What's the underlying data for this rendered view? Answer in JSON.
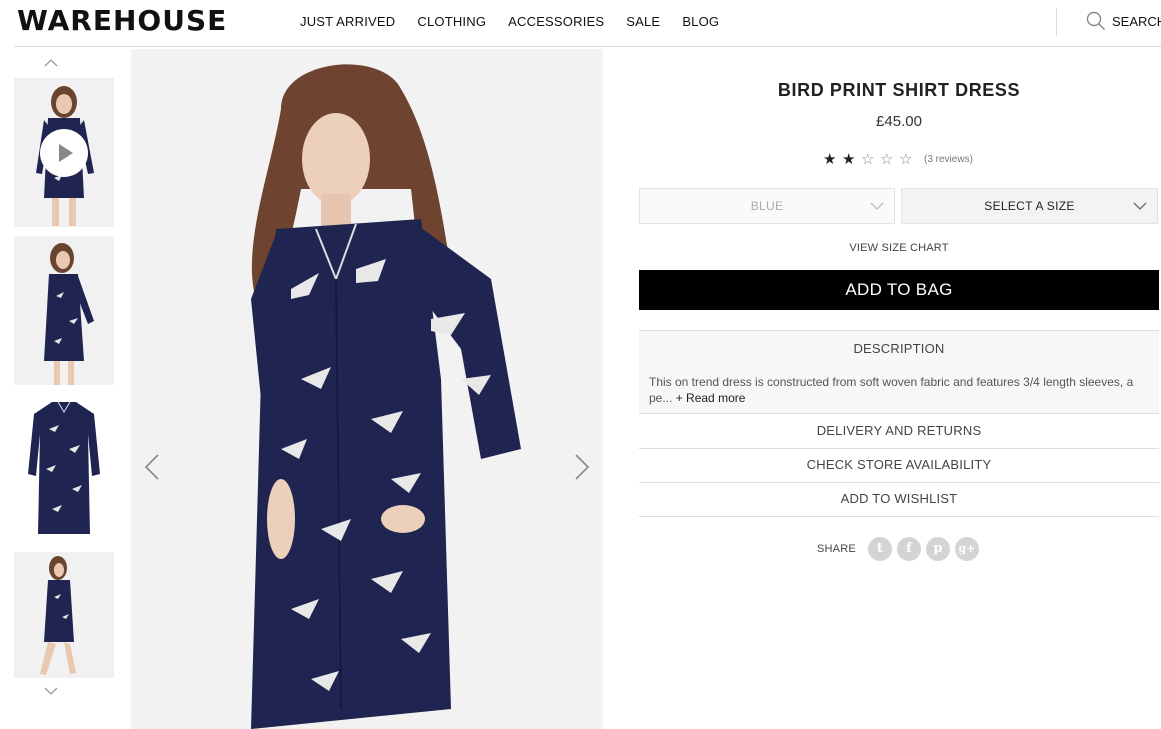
{
  "header": {
    "logo": "WAREHOUSE",
    "nav": [
      "JUST ARRIVED",
      "CLOTHING",
      "ACCESSORIES",
      "SALE",
      "BLOG"
    ],
    "search_label": "SEARCH"
  },
  "gallery": {
    "thumbnails": [
      {
        "icon": "video-thumbnail",
        "has_play": true
      },
      {
        "icon": "model-side-thumbnail"
      },
      {
        "icon": "dress-flat-thumbnail"
      },
      {
        "icon": "model-walking-thumbnail"
      }
    ]
  },
  "product": {
    "title": "BIRD PRINT SHIRT DRESS",
    "price": "£45.00",
    "rating": 2,
    "rating_max": 5,
    "reviews": "(3 reviews)",
    "color_select": "BLUE",
    "size_select": "SELECT A SIZE",
    "size_chart": "VIEW SIZE CHART",
    "add_to_bag": "ADD TO BAG",
    "description_heading": "DESCRIPTION",
    "description_text": "This on trend dress is constructed from soft woven fabric and features 3/4 length sleeves, a pe...",
    "read_more": "+ Read more",
    "accordion": [
      "DELIVERY AND RETURNS",
      "CHECK STORE AVAILABILITY",
      "ADD TO WISHLIST"
    ],
    "share_label": "SHARE",
    "social": [
      {
        "icon": "twitter-icon",
        "glyph": "t"
      },
      {
        "icon": "facebook-icon",
        "glyph": "f"
      },
      {
        "icon": "pinterest-icon",
        "glyph": "p"
      },
      {
        "icon": "googleplus-icon",
        "glyph": "g+"
      }
    ]
  },
  "colors": {
    "dress_navy": "#1f2550",
    "button_black": "#000000",
    "social_grey": "#d4d4d4"
  }
}
